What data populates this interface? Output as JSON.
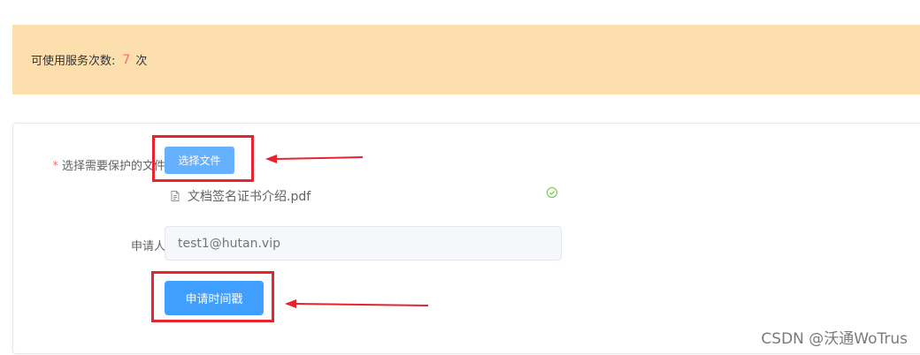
{
  "notice": {
    "label": "可使用服务次数:",
    "count": "7",
    "unit": "次"
  },
  "form": {
    "file_label": "选择需要保护的文件",
    "required_mark": "*",
    "choose_button": "选择文件",
    "uploaded_file": "文档签名证书介绍.pdf",
    "applicant_label": "申请人",
    "applicant_placeholder": "test1@hutan.vip",
    "apply_button": "申请时间戳"
  },
  "watermark": "CSDN @沃通WoTrus",
  "colors": {
    "notice_bg": "#fddead",
    "count": "#f56c6c",
    "primary": "#409eff",
    "primary_light": "#66b1ff",
    "annotation": "#e6242d",
    "success": "#67c23a"
  }
}
